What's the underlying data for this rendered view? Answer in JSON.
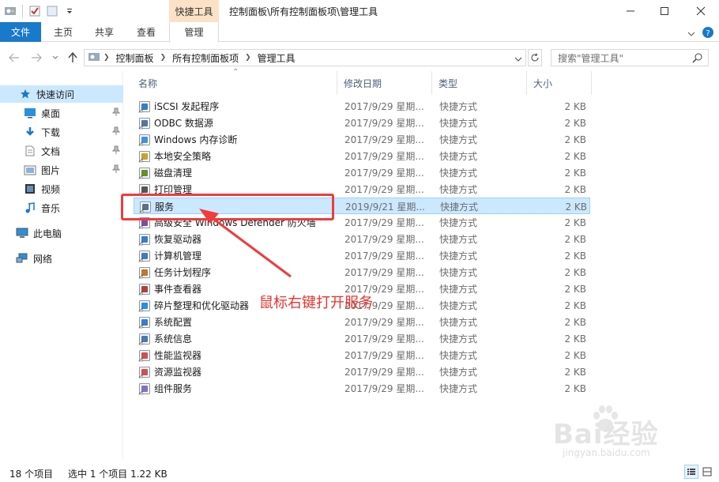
{
  "titlebar": {
    "context_tab_header": "快捷工具",
    "window_title": "控制面板\\所有控制面板项\\管理工具"
  },
  "ribbon": {
    "tabs": [
      "文件",
      "主页",
      "共享",
      "查看",
      "管理"
    ]
  },
  "address": {
    "crumbs": [
      "控制面板",
      "所有控制面板项",
      "管理工具"
    ],
    "search_placeholder": "搜索\"管理工具\""
  },
  "sidebar": {
    "quick_access": "快速访问",
    "pinned": [
      {
        "label": "桌面",
        "icon": "desktop-icon"
      },
      {
        "label": "下载",
        "icon": "download-icon"
      },
      {
        "label": "文档",
        "icon": "document-icon"
      },
      {
        "label": "图片",
        "icon": "picture-icon"
      }
    ],
    "folders": [
      {
        "label": "视频",
        "icon": "video-icon"
      },
      {
        "label": "音乐",
        "icon": "music-icon"
      }
    ],
    "this_pc": "此电脑",
    "network": "网络"
  },
  "columns": {
    "name": "名称",
    "date": "修改日期",
    "type": "类型",
    "size": "大小"
  },
  "files": [
    {
      "name": "iSCSI 发起程序",
      "date": "2017/9/29 星期...",
      "type": "快捷方式",
      "size": "2 KB",
      "icon": "iscsi-icon"
    },
    {
      "name": "ODBC 数据源",
      "date": "2017/9/29 星期...",
      "type": "快捷方式",
      "size": "2 KB",
      "icon": "odbc-icon"
    },
    {
      "name": "Windows 内存诊断",
      "date": "2017/9/29 星期...",
      "type": "快捷方式",
      "size": "2 KB",
      "icon": "memory-diagnostic-icon"
    },
    {
      "name": "本地安全策略",
      "date": "2017/9/29 星期...",
      "type": "快捷方式",
      "size": "2 KB",
      "icon": "security-policy-icon"
    },
    {
      "name": "磁盘清理",
      "date": "2017/9/29 星期...",
      "type": "快捷方式",
      "size": "2 KB",
      "icon": "disk-cleanup-icon"
    },
    {
      "name": "打印管理",
      "date": "2017/9/29 星期...",
      "type": "快捷方式",
      "size": "2 KB",
      "icon": "print-icon"
    },
    {
      "name": "服务",
      "date": "2019/9/21 星期...",
      "type": "快捷方式",
      "size": "2 KB",
      "icon": "services-gear-icon",
      "selected": true
    },
    {
      "name": "高级安全 Windows Defender 防火墙",
      "date": "2017/9/29 星期...",
      "type": "快捷方式",
      "size": "2 KB",
      "icon": "firewall-icon"
    },
    {
      "name": "恢复驱动器",
      "date": "2017/9/29 星期...",
      "type": "快捷方式",
      "size": "2 KB",
      "icon": "recovery-drive-icon"
    },
    {
      "name": "计算机管理",
      "date": "2017/9/29 星期...",
      "type": "快捷方式",
      "size": "2 KB",
      "icon": "computer-management-icon"
    },
    {
      "name": "任务计划程序",
      "date": "2017/9/29 星期...",
      "type": "快捷方式",
      "size": "2 KB",
      "icon": "task-scheduler-icon"
    },
    {
      "name": "事件查看器",
      "date": "2017/9/29 星期...",
      "type": "快捷方式",
      "size": "2 KB",
      "icon": "event-viewer-icon"
    },
    {
      "name": "碎片整理和优化驱动器",
      "date": "2017/9/29 星期...",
      "type": "快捷方式",
      "size": "2 KB",
      "icon": "defrag-icon"
    },
    {
      "name": "系统配置",
      "date": "2017/9/29 星期...",
      "type": "快捷方式",
      "size": "2 KB",
      "icon": "system-config-icon"
    },
    {
      "name": "系统信息",
      "date": "2017/9/29 星期...",
      "type": "快捷方式",
      "size": "2 KB",
      "icon": "system-info-icon"
    },
    {
      "name": "性能监视器",
      "date": "2017/9/29 星期...",
      "type": "快捷方式",
      "size": "2 KB",
      "icon": "performance-monitor-icon"
    },
    {
      "name": "资源监视器",
      "date": "2017/9/29 星期...",
      "type": "快捷方式",
      "size": "2 KB",
      "icon": "resource-monitor-icon"
    },
    {
      "name": "组件服务",
      "date": "2017/9/29 星期...",
      "type": "快捷方式",
      "size": "2 KB",
      "icon": "component-services-icon"
    }
  ],
  "annotation": {
    "text": "鼠标右键打开服务",
    "color": "#e8332c"
  },
  "watermark": {
    "brand": "Bai经验",
    "url": "jingyan.baidu.com"
  },
  "status": {
    "count": "18 个项目",
    "selection": "选中 1 个项目  1.22 KB"
  },
  "colors": {
    "accent": "#1979ca",
    "selection": "#cce8ff",
    "context_tab": "#fbe2c6"
  }
}
